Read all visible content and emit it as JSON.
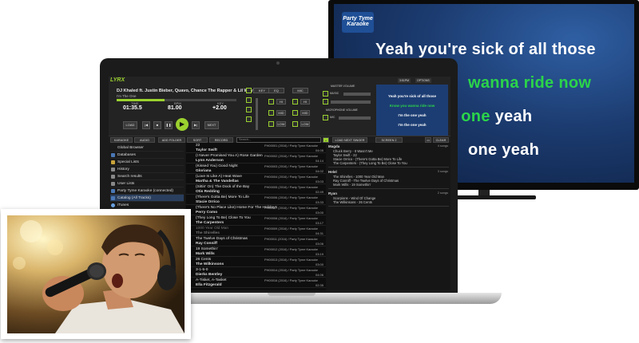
{
  "tv": {
    "logo_line1": "Party Tyme",
    "logo_line2": "Karaoke",
    "lines": [
      {
        "text": "Yeah you're sick of all those",
        "color": "#ffffff"
      },
      {
        "text": "wanna ride now",
        "color": "#2bd44a"
      },
      {
        "text": "one yeah",
        "prefix": "e ",
        "prefix_color": "#2bd44a",
        "color": "#ffffff"
      },
      {
        "text": "one yeah",
        "color": "#ffffff"
      }
    ]
  },
  "app": {
    "logo": "LYRX",
    "now_playing": {
      "title": "DJ Khaled ft. Justin Bieber, Quavo, Chance The Rapper & Lil Wayne",
      "subtitle": "I'm The One",
      "progress": 0.4,
      "time_label": "TIME",
      "time_value": "01:35.5",
      "bpm_label": "BPM",
      "bpm_value": "81.00",
      "key_label": "KEY",
      "key_value": "+2.00"
    },
    "transport": {
      "load": "LOAD",
      "next": "NEXT"
    },
    "mixer": {
      "key": "KEY",
      "eq": "EQ",
      "mic": "MIC",
      "hi": "HI",
      "mid": "MID",
      "low": "LOW"
    },
    "volumes": {
      "master": "MASTER VOLUME",
      "music": "MUSIC",
      "microphone": "MICROPHONE VOLUME",
      "mic": "MIC"
    },
    "options": {
      "a": "3:51PM",
      "b": "OPTIONS"
    },
    "lyrics_mini": [
      "Yeah you're sick of all those",
      "Know you wanna ride now",
      "I'm the one yeah",
      "I'm the one yeah"
    ],
    "toolbar": {
      "karaoke": "KARAOKE",
      "audio": "AUDIO",
      "add_folder": "ADD FOLDER",
      "sort": "SORT",
      "record": "RECORD",
      "search_placeholder": "Search...",
      "load_next": "LOAD NEXT SINGER",
      "screen": "SCREEN 2",
      "clear": "CLEAR"
    },
    "browser": [
      "Global Browser",
      "Databases",
      "Special Lists",
      "History",
      "Search results",
      "User Lists",
      "Party Tyme Karaoke (connected)",
      "Catalog (All Tracks)",
      "iTunes"
    ],
    "songs": [
      {
        "title": "22",
        "artist": "Taylor Swift",
        "id": "PH00001 (2016) / Party Tyme Karaoke",
        "dur": "04:05",
        "dim": false
      },
      {
        "title": "(I Never Promised You A) Rose Garden",
        "artist": "Lynn Anderson",
        "id": "PH00002 (2016) / Party Tyme Karaoke",
        "dur": "04:14",
        "dim": false
      },
      {
        "title": "(Kissed You) Good Night",
        "artist": "Gloriana",
        "id": "PH00003 (2016) / Party Tyme Karaoke",
        "dur": "04:02",
        "dim": false
      },
      {
        "title": "(Love Is Like A) Heat Wave",
        "artist": "Martha & The Vandellas",
        "id": "PH00004 (2016) / Party Tyme Karaoke",
        "dur": "03:03",
        "dim": false
      },
      {
        "title": "(Sittin' On) The Dock of the Bay",
        "artist": "Otis Redding",
        "id": "PH00005 (2016) / Party Tyme Karaoke",
        "dur": "02:49",
        "dim": false
      },
      {
        "title": "(There's Gotta Be) More To Life",
        "artist": "Stacie Orrico",
        "id": "PH00006 (2016) / Party Tyme Karaoke",
        "dur": "03:33",
        "dim": false
      },
      {
        "title": "(There's No Place Like) Home For The Holidays",
        "artist": "Perry Como",
        "id": "PH00007 (2016) / Party Tyme Karaoke",
        "dur": "03:00",
        "dim": false
      },
      {
        "title": "(They Long To Be) Close To You",
        "artist": "The Carpenters",
        "id": "PH00008 (2016) / Party Tyme Karaoke",
        "dur": "03:17",
        "dim": false
      },
      {
        "title": "1000 Year Old Man",
        "artist": "The Shirelles",
        "id": "PH00009 (2016) / Party Tyme Karaoke",
        "dur": "04:31",
        "dim": true
      },
      {
        "title": "The Twelve Days of Christmas",
        "artist": "Ray Conniff",
        "id": "PH00011 (2016) / Party Tyme Karaoke",
        "dur": "03:06",
        "dim": false
      },
      {
        "title": "19 Somethin'",
        "artist": "Mark Wills",
        "id": "PH00012 (2016) / Party Tyme Karaoke",
        "dur": "03:19",
        "dim": false
      },
      {
        "title": "26 Cents",
        "artist": "The Wilkinsons",
        "id": "PH00013 (2016) / Party Tyme Karaoke",
        "dur": "03:00",
        "dim": false
      },
      {
        "title": "3-1-5-0",
        "artist": "Dierks Bentley",
        "id": "PH00014 (2016) / Party Tyme Karaoke",
        "dur": "04:06",
        "dim": false
      },
      {
        "title": "A-Tisket, A-Tasket",
        "artist": "Ella Fitzgerald",
        "id": "PH00016 (2016) / Party Tyme Karaoke",
        "dur": "02:35",
        "dim": false
      }
    ],
    "queue": [
      {
        "singer": "Magda",
        "count": "4 songs",
        "songs": [
          "Chuck Berry - It Wasn't Me",
          "Taylor Swift - 22",
          "Stacie Orrico - (There's Gotta Be) More To Life",
          "The Carpenters - (They Long To Be) Close To You"
        ]
      },
      {
        "singer": "Helel",
        "count": "3 songs",
        "songs": [
          "The Shirelles - 1000 Year Old Man",
          "Ray Conniff - The Twelve Days of Christmas",
          "Mark Wills - 19 Somethin'"
        ]
      },
      {
        "singer": "Ryan",
        "count": "2 songs",
        "songs": [
          "Scorpions - Wind Of Change",
          "The Wilkinsons - 26 Cents"
        ]
      }
    ]
  }
}
